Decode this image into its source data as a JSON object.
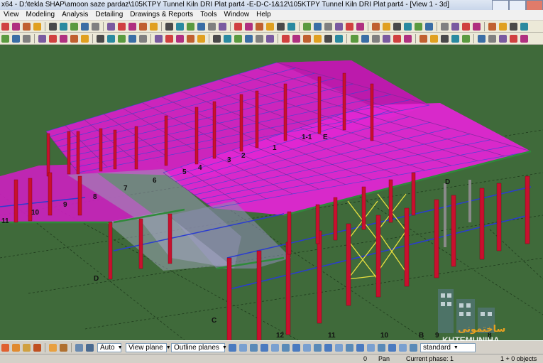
{
  "window": {
    "title": "x64 - D:\\tekla SHAP\\amoon saze pardaz\\105KTPY Tunnel Kiln DRI Plat part4 -E-D-C-1&12\\105KTPY Tunnel Kiln DRI Plat part4 - [View 1 - 3d]"
  },
  "menu": [
    "View",
    "Modeling",
    "Analysis",
    "Detailing",
    "Drawings & Reports",
    "Tools",
    "Window",
    "Help"
  ],
  "grid_labels": {
    "top_row": [
      "1-1",
      "E",
      "1",
      "2",
      "3",
      "4",
      "5",
      "6",
      "7",
      "8",
      "9",
      "10",
      "11"
    ],
    "letters": [
      "D",
      "D",
      "C"
    ],
    "bottom_row": [
      "12",
      "11",
      "10",
      "B",
      "9",
      "8"
    ]
  },
  "bottombar": {
    "select_auto": "Auto",
    "select_view_plane": "View plane",
    "select_outline_planes": "Outline planes",
    "select_standard": "standard"
  },
  "status": {
    "coord": "0",
    "mode": "Pan",
    "phase": "Current phase: 1",
    "objects": "1 + 0 objects"
  },
  "watermark": {
    "text": "KHTEMUNIHA",
    "arabic": "ساختمونی"
  },
  "colors": {
    "ground": "#3f6a3a",
    "columns": "#c8102e",
    "roof": "#e020d0",
    "bracing_x": "#e8e040",
    "purlins": "#2a4cd8"
  }
}
